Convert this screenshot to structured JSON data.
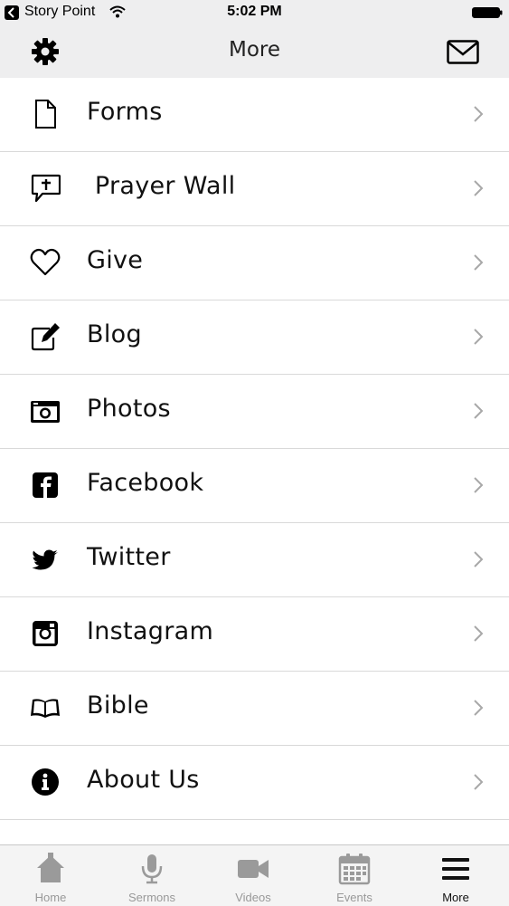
{
  "status_bar": {
    "carrier": "Story Point",
    "time": "5:02 PM"
  },
  "nav": {
    "title": "More"
  },
  "menu": {
    "items": [
      {
        "label": "Forms",
        "icon": "document-icon"
      },
      {
        "label": " Prayer Wall",
        "icon": "prayer-bubble-icon"
      },
      {
        "label": "Give",
        "icon": "heart-icon"
      },
      {
        "label": "Blog",
        "icon": "edit-icon"
      },
      {
        "label": "Photos",
        "icon": "camera-icon"
      },
      {
        "label": "Facebook",
        "icon": "facebook-icon"
      },
      {
        "label": "Twitter",
        "icon": "twitter-icon"
      },
      {
        "label": "Instagram",
        "icon": "instagram-icon"
      },
      {
        "label": "Bible",
        "icon": "book-icon"
      },
      {
        "label": "About Us",
        "icon": "info-icon"
      }
    ]
  },
  "tabs": [
    {
      "label": "Home",
      "icon": "home-icon"
    },
    {
      "label": "Sermons",
      "icon": "microphone-icon"
    },
    {
      "label": "Videos",
      "icon": "video-camera-icon"
    },
    {
      "label": "Events",
      "icon": "calendar-icon"
    },
    {
      "label": "More",
      "icon": "menu-icon",
      "active": true
    }
  ],
  "colors": {
    "bar_background": "#eeeeef",
    "tab_inactive": "#999999",
    "tab_active": "#111111",
    "separator": "#d9d9d9"
  }
}
